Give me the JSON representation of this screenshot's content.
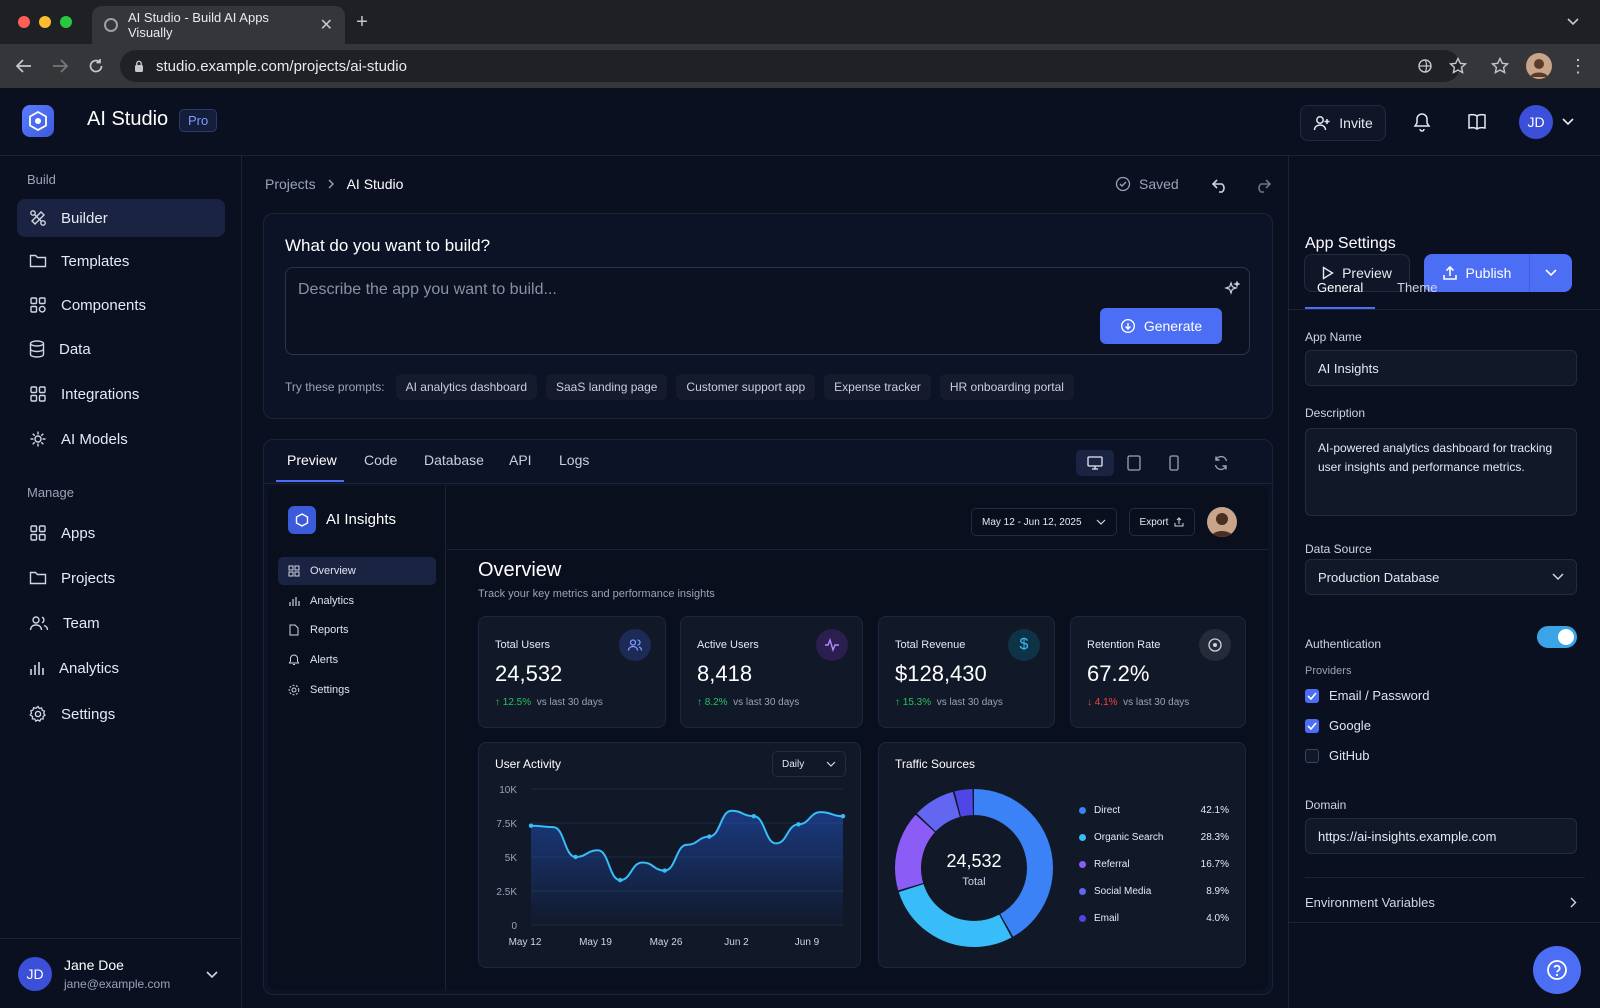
{
  "browser": {
    "tab_title": "AI Studio - Build AI Apps Visually",
    "url": "studio.example.com/projects/ai-studio"
  },
  "app": {
    "title": "AI Studio",
    "plan_badge": "Pro",
    "invite": "Invite",
    "avatar_initials": "JD"
  },
  "sidebar": {
    "build_label": "Build",
    "build_items": [
      {
        "label": "Builder"
      },
      {
        "label": "Templates"
      },
      {
        "label": "Components"
      },
      {
        "label": "Data"
      },
      {
        "label": "Integrations"
      },
      {
        "label": "AI Models"
      }
    ],
    "manage_label": "Manage",
    "manage_items": [
      {
        "label": "Apps"
      },
      {
        "label": "Projects"
      },
      {
        "label": "Team"
      },
      {
        "label": "Analytics"
      },
      {
        "label": "Settings"
      }
    ],
    "user": {
      "initials": "JD",
      "name": "Jane Doe",
      "email": "jane@example.com"
    }
  },
  "toolbar": {
    "crumb_parent": "Projects",
    "crumb_current": "AI Studio",
    "saved": "Saved",
    "preview": "Preview",
    "publish": "Publish"
  },
  "builder": {
    "heading": "What do you want to build?",
    "placeholder": "Describe the app you want to build...",
    "generate": "Generate",
    "try_label": "Try these prompts:",
    "prompts": [
      "AI analytics dashboard",
      "SaaS landing page",
      "Customer support app",
      "Expense tracker",
      "HR onboarding portal"
    ]
  },
  "preview_tabs": [
    "Preview",
    "Code",
    "Database",
    "API",
    "Logs"
  ],
  "inner_app": {
    "name": "AI Insights",
    "nav": [
      "Overview",
      "Analytics",
      "Reports",
      "Alerts",
      "Settings"
    ],
    "date_range": "May 12 - Jun 12, 2025",
    "export": "Export",
    "title": "Overview",
    "subtitle": "Track your key metrics and performance insights",
    "metrics": [
      {
        "label": "Total Users",
        "value": "24,532",
        "delta": "12.5%",
        "direction": "up",
        "note": "vs last 30 days",
        "icon": "users-icon",
        "icon_color": "#7c9bff"
      },
      {
        "label": "Active Users",
        "value": "8,418",
        "delta": "8.2%",
        "direction": "up",
        "note": "vs last 30 days",
        "icon": "activity-icon",
        "icon_color": "#b38bff"
      },
      {
        "label": "Total Revenue",
        "value": "$128,430",
        "delta": "15.3%",
        "direction": "up",
        "note": "vs last 30 days",
        "icon": "dollar-icon",
        "icon_color": "#38bdf8"
      },
      {
        "label": "Retention Rate",
        "value": "67.2%",
        "delta": "4.1%",
        "direction": "down",
        "note": "vs last 30 days",
        "icon": "target-icon",
        "icon_color": "#cbd5e1"
      }
    ],
    "activity": {
      "title": "User Activity",
      "period": "Daily"
    },
    "traffic": {
      "title": "Traffic Sources",
      "total": "24,532",
      "total_label": "Total"
    }
  },
  "chart_data": [
    {
      "type": "area",
      "title": "User Activity",
      "x": [
        "May 12",
        "May 19",
        "May 26",
        "Jun 2",
        "Jun 9"
      ],
      "ylim": [
        0,
        10000
      ],
      "yticks": [
        "0",
        "2.5K",
        "5K",
        "7.5K",
        "10K"
      ],
      "points": [
        7300,
        7200,
        5000,
        5500,
        3300,
        4600,
        4000,
        5900,
        6500,
        8400,
        8000,
        6000,
        7400,
        8300,
        8000
      ],
      "color": "#38bdf8"
    },
    {
      "type": "pie",
      "title": "Traffic Sources",
      "labels": [
        "Direct",
        "Organic Search",
        "Referral",
        "Social Media",
        "Email"
      ],
      "values": [
        42.1,
        28.3,
        16.7,
        8.9,
        4.0
      ],
      "value_labels": [
        "42.1%",
        "28.3%",
        "16.7%",
        "8.9%",
        "4.0%"
      ],
      "colors": [
        "#3b82f6",
        "#38bdf8",
        "#8b5cf6",
        "#6366f1",
        "#4f46e5"
      ]
    }
  ],
  "settings": {
    "title": "App Settings",
    "tab_general": "General",
    "tab_theme": "Theme",
    "app_name_label": "App Name",
    "app_name": "AI Insights",
    "description_label": "Description",
    "description": "AI-powered analytics dashboard for tracking user insights and performance metrics.",
    "data_source_label": "Data Source",
    "data_source": "Production Database",
    "auth_label": "Authentication",
    "auth_enabled": true,
    "providers_label": "Providers",
    "providers": [
      {
        "label": "Email / Password",
        "checked": true
      },
      {
        "label": "Google",
        "checked": true
      },
      {
        "label": "GitHub",
        "checked": false
      }
    ],
    "domain_label": "Domain",
    "domain": "https://ai-insights.example.com",
    "env_label": "Environment Variables"
  },
  "colors": {
    "accent": "#4c6ef5",
    "bg": "#0b1020",
    "positive": "#22c55e",
    "negative": "#ef4444"
  }
}
